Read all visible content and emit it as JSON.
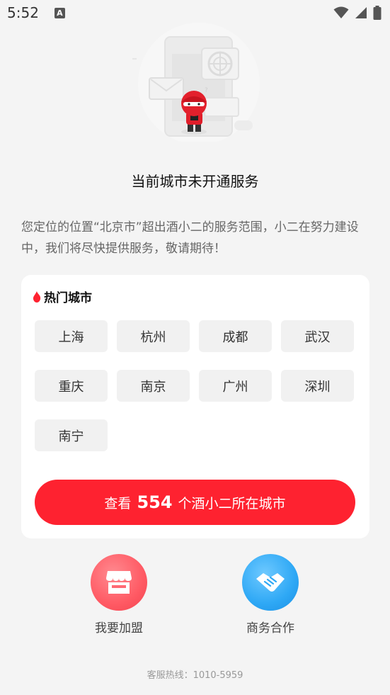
{
  "status_bar": {
    "time": "5:52",
    "indicator": "A"
  },
  "page": {
    "title": "当前城市未开通服务",
    "description": "您定位的位置“北京市”超出酒小二的服务范围，小二在努力建设中，我们将尽快提供服务，敬请期待！"
  },
  "hot_cities": {
    "title": "热门城市",
    "cities": [
      "上海",
      "杭州",
      "成都",
      "武汉",
      "重庆",
      "南京",
      "广州",
      "深圳",
      "南宁"
    ]
  },
  "view_button": {
    "prefix": "查看",
    "count": "554",
    "suffix": "个酒小二所在城市"
  },
  "actions": {
    "join_label": "我要加盟",
    "coop_label": "商务合作"
  },
  "footer": {
    "hotline": "客服热线：1010-5959"
  },
  "colors": {
    "accent": "#fe2230",
    "join_gradient": "#ff5a64",
    "coop_gradient": "#2ea8f5"
  }
}
